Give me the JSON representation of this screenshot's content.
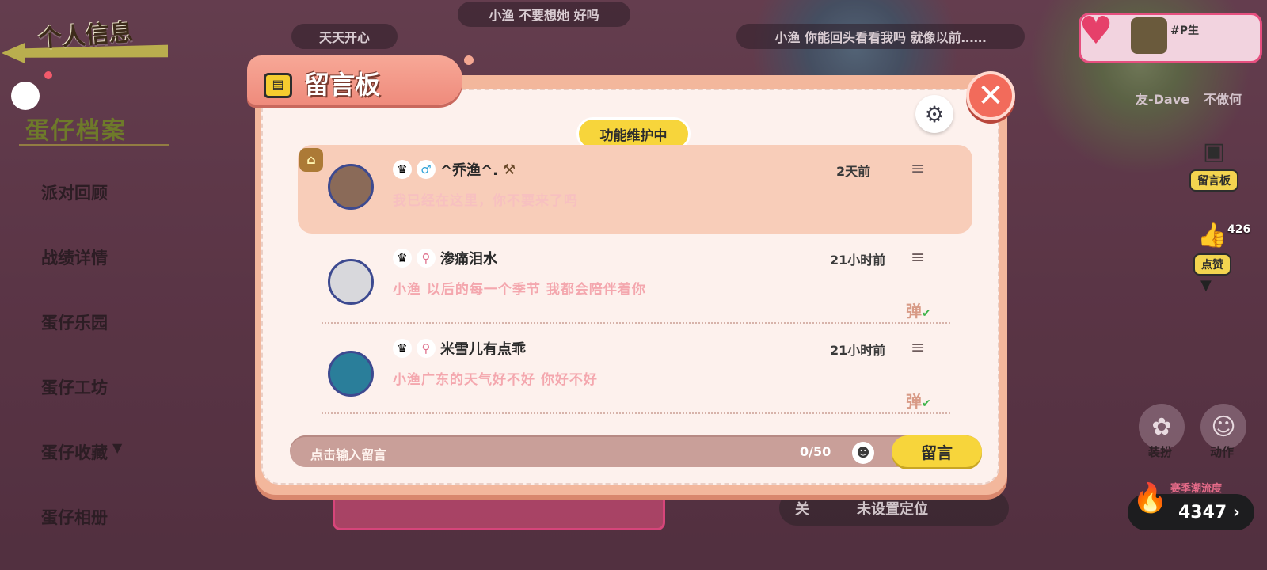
{
  "background": {
    "pills": [
      "小渔 不要想她 好吗",
      "天天开心",
      "小渔 你能回头看看我吗 就像以前……"
    ]
  },
  "left_panel": {
    "title": "个人信息",
    "subtitle": "蛋仔档案",
    "menu": [
      "派对回顾",
      "战绩详情",
      "蛋仔乐园",
      "蛋仔工坊",
      "蛋仔收藏",
      "蛋仔相册"
    ]
  },
  "right_panel": {
    "profile_name": "#P生",
    "friend_name": "友-Dave",
    "friend_status": "不做何",
    "board_button": "留言板",
    "like_button": "点赞",
    "like_count": "426",
    "dress_button": "装扮",
    "action_button": "动作",
    "heat_label": "赛季潮流度",
    "heat_value": "4347",
    "location_off": "关",
    "location_text": "未设置定位"
  },
  "dialog": {
    "title": "留言板",
    "status_badge": "功能维护中",
    "messages": [
      {
        "name": "^乔渔^.",
        "time": "2天前",
        "text": "我已经在这里，你不要来了吗",
        "pinned": true
      },
      {
        "name": "渗痛泪水",
        "time": "21小时前",
        "text": "小渔 以后的每一个季节 我都会陪伴着你",
        "danmu": "弹"
      },
      {
        "name": "米雪儿有点乖",
        "time": "21小时前",
        "text": "小渔广东的天气好不好 你好不好",
        "danmu": "弹"
      }
    ],
    "input_placeholder": "点击输入留言",
    "char_count": "0/50",
    "send_label": "留言"
  },
  "colors": {
    "accent_yellow": "#f7d53b",
    "dialog_bg": "#fdf1ed",
    "pinned_bg": "#f8cdb9",
    "close_red": "#f26b5b"
  }
}
